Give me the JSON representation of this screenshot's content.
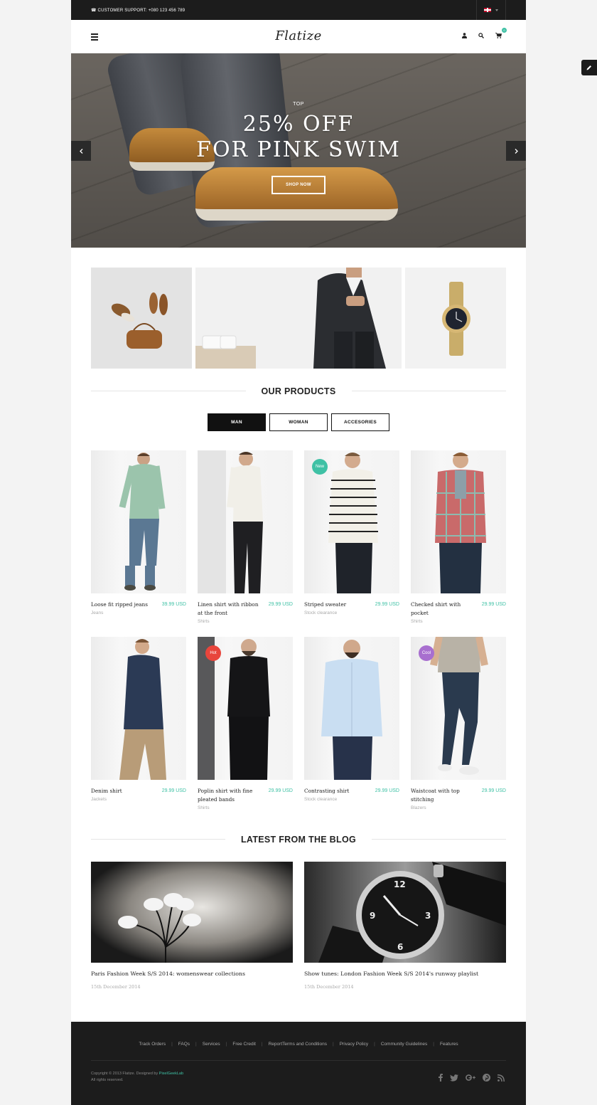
{
  "topbar": {
    "support_text": "☎ CUSTOMER SUPPORT: +080 123 456 789",
    "language_flag": "uk-flag-icon"
  },
  "header": {
    "logo": "Flatize",
    "cart_count": "0",
    "icons": [
      "menu-icon",
      "user-icon",
      "search-icon",
      "cart-icon"
    ]
  },
  "hero": {
    "small_label": "TOP",
    "title_line1": "25% OFF",
    "title_line2": "FOR PINK SWIM",
    "button_label": "SHOP NOW"
  },
  "products_section": {
    "title": "OUR PRODUCTS",
    "tabs": [
      "MAN",
      "WOMAN",
      "ACCESORIES"
    ],
    "active_tab": "MAN",
    "items": [
      {
        "name": "Loose fit ripped jeans",
        "price": "39.99 USD",
        "category": "Jeans",
        "badge": ""
      },
      {
        "name": "Linen shirt with ribbon at the front",
        "price": "29.99 USD",
        "category": "Shirts",
        "badge": ""
      },
      {
        "name": "Striped sweater",
        "price": "29.99 USD",
        "category": "Stock clearance",
        "badge": "New"
      },
      {
        "name": "Checked shirt with pocket",
        "price": "29.99 USD",
        "category": "Shirts",
        "badge": ""
      },
      {
        "name": "Denim shirt",
        "price": "29.99 USD",
        "category": "Jackets",
        "badge": ""
      },
      {
        "name": "Poplin shirt with fine pleated bands",
        "price": "29.99 USD",
        "category": "Shirts",
        "badge": "Hot"
      },
      {
        "name": "Contrasting shirt",
        "price": "29.99 USD",
        "category": "Stock clearance",
        "badge": ""
      },
      {
        "name": "Waistcoat with top stitching",
        "price": "29.99 USD",
        "category": "Blazers",
        "badge": "Cool"
      }
    ]
  },
  "blog_section": {
    "title": "LATEST FROM THE BLOG",
    "posts": [
      {
        "title": "Paris Fashion Week S/S 2014: womenswear collections",
        "date": "15th December 2014"
      },
      {
        "title": "Show tunes: London Fashion Week S/S 2014's runway playlist",
        "date": "15th December 2014"
      }
    ]
  },
  "footer": {
    "links": [
      "Track Orders",
      "FAQs",
      "Services",
      "Free Credit",
      "ReportTerms and Conditions",
      "Privacy Policy",
      "Community Guidelines",
      "Features"
    ],
    "copyright_prefix": "Copyright © 2013 Flatize. Designed by ",
    "copyright_link": "PixelGeekLab",
    "rights": "All rights reserved.",
    "social": [
      "facebook-icon",
      "twitter-icon",
      "google-plus-icon",
      "pinterest-icon",
      "rss-icon"
    ]
  },
  "colors": {
    "accent": "#3fc1a5",
    "badge_new": "#3fc1a5",
    "badge_hot": "#e8453c",
    "badge_cool": "#a86fcf",
    "dark": "#1c1c1c"
  }
}
